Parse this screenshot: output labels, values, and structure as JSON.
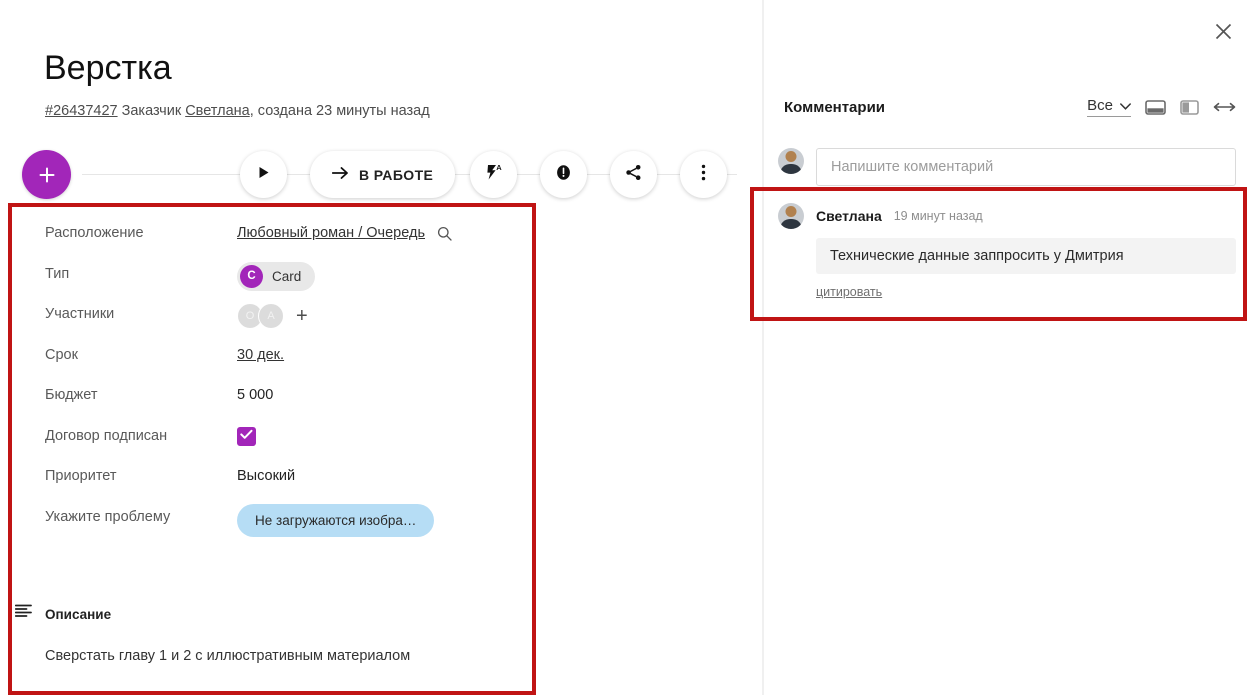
{
  "window": {
    "close_label": "×"
  },
  "ticket": {
    "title": "Верстка",
    "id": "#26437427",
    "customer_label": "Заказчик",
    "customer_name": "Светлана",
    "created_text": ", создана 23 минуты назад"
  },
  "toolbar": {
    "add_label": "+",
    "play_label": "play-icon",
    "status_label": "В РАБОТЕ",
    "status_arrow": "→",
    "flash_label": "flash-auto-icon",
    "alert_label": "alert-icon",
    "share_label": "share-icon",
    "more_label": "more-icon"
  },
  "fields": [
    {
      "label": "Расположение",
      "type": "link",
      "value": "Любовный роман / Очередь",
      "icon": "search-icon"
    },
    {
      "label": "Тип",
      "type": "chip",
      "badge": "C",
      "value": "Card"
    },
    {
      "label": "Участники",
      "type": "avatars",
      "avatars": [
        "О",
        "А"
      ],
      "add_label": "+"
    },
    {
      "label": "Срок",
      "type": "link",
      "value": "30 дек."
    },
    {
      "label": "Бюджет",
      "type": "text",
      "value": "5 000"
    },
    {
      "label": "Договор подписан",
      "type": "checkbox",
      "checked": true
    },
    {
      "label": "Приоритет",
      "type": "text",
      "value": "Высокий"
    },
    {
      "label": "Укажите проблему",
      "type": "chip-blue",
      "value": "Не загружаются изобра…"
    }
  ],
  "description": {
    "icon": "description-icon",
    "title": "Описание",
    "body": "Сверстать главу 1 и 2 с иллюстративным материалом"
  },
  "comments": {
    "title": "Комментарии",
    "filter_label": "Все",
    "filter_caret": "▾",
    "layout_icon_1": "split-horizontal-icon",
    "layout_icon_2": "split-vertical-icon",
    "layout_icon_3": "resize-horizontal-icon",
    "input_placeholder": "Напишите комментарий",
    "items": [
      {
        "author": "Светлана",
        "time": "19 минут назад",
        "text": "Технические данные заппросить у Дмитрия",
        "quote_label": "цитировать"
      }
    ]
  },
  "colors": {
    "accent": "#a226b9",
    "highlight": "#c01414",
    "chip_blue": "#b6ddf5",
    "chip_gray": "#e8e8e8"
  }
}
